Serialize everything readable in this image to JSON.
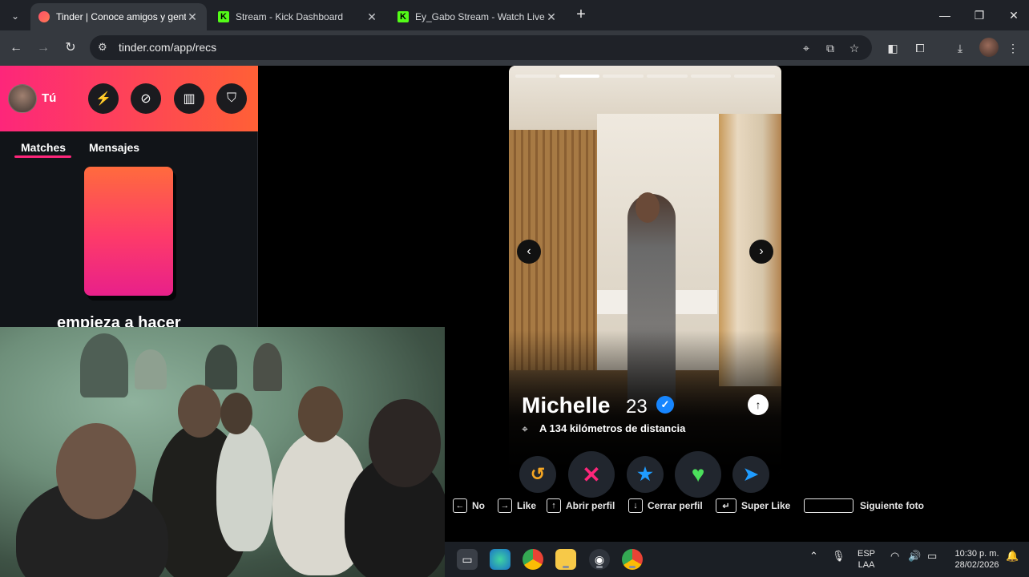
{
  "browser": {
    "tabs": [
      {
        "title": "Tinder | Conoce amigos y gente",
        "favicon": "tinder-flame-icon",
        "active": true
      },
      {
        "title": "Stream - Kick Dashboard",
        "favicon": "kick-logo-icon",
        "active": false
      },
      {
        "title": "Ey_Gabo Stream - Watch Live o",
        "favicon": "kick-logo-icon",
        "active": false
      }
    ],
    "url": "tinder.com/app/recs",
    "kick_letter": "K"
  },
  "tinder": {
    "user_label": "Tú",
    "panel_tabs": [
      "Matches",
      "Mensajes"
    ],
    "empty_state_text": "empieza a hacer",
    "profile": {
      "name": "Michelle",
      "age": "23",
      "distance": "A 134 kilómetros de distancia",
      "photo_count": 6,
      "active_photo": 1
    },
    "actions": [
      {
        "name": "rewind",
        "glyph": "↺",
        "color": "#f5a623"
      },
      {
        "name": "nope",
        "glyph": "✕",
        "color": "#fd267a"
      },
      {
        "name": "super-like",
        "glyph": "★",
        "color": "#1f9cff"
      },
      {
        "name": "like",
        "glyph": "♥",
        "color": "#4ce05c"
      },
      {
        "name": "boost",
        "glyph": "➤",
        "color": "#1f9cff"
      }
    ],
    "hints": [
      {
        "key": "←",
        "label": "No"
      },
      {
        "key": "→",
        "label": "Like"
      },
      {
        "key": "↑",
        "label": "Abrir perfil"
      },
      {
        "key": "↓",
        "label": "Cerrar perfil"
      },
      {
        "key": "↵",
        "label": "Super Like"
      },
      {
        "key": "",
        "label": "Siguiente foto"
      }
    ]
  },
  "taskbar": {
    "language": "ESP",
    "layout": "LAA",
    "time": "10:30 p. m.",
    "date": "28/02/2026"
  },
  "colors": {
    "tinder_gradient_start": "#fd267a",
    "tinder_gradient_end": "#ff6036",
    "verified_blue": "#1786ff"
  }
}
